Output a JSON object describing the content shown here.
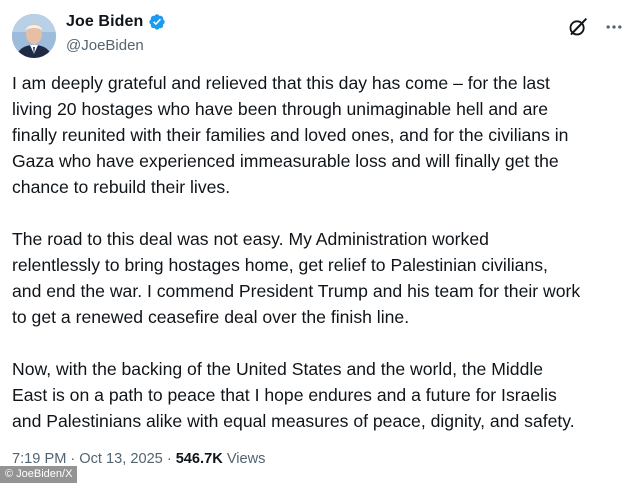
{
  "author": {
    "display_name": "Joe Biden",
    "handle": "@JoeBiden",
    "verified": true
  },
  "icons": {
    "avatar": "profile-photo",
    "verified": "verified-badge-icon",
    "grok": "grok-icon",
    "more": "more-icon"
  },
  "colors": {
    "verified_blue": "#1d9bf0",
    "text_primary": "#0f1419",
    "text_secondary": "#536471"
  },
  "post": {
    "paragraphs": [
      "I am deeply grateful and relieved that this day has come – for the last\nliving 20 hostages who have been through unimaginable hell and are\nfinally reunited with their families and loved ones, and for the civilians in\nGaza who have experienced immeasurable loss and will finally get the\nchance to rebuild their lives.",
      "The road to this deal was not easy. My Administration worked\nrelentlessly to bring hostages home, get relief to Palestinian civilians,\nand end the war. I commend President Trump and his team for their work\nto get a renewed ceasefire deal over the finish line.",
      "Now, with the backing of the United States and the world, the Middle\nEast is on a path to peace that I hope endures and a future for Israelis\nand Palestinians alike with equal measures of peace, dignity, and safety."
    ]
  },
  "meta": {
    "time": "7:19 PM",
    "separator": "·",
    "date": "Oct 13, 2025",
    "views_count": "546.7K",
    "views_label": "Views"
  },
  "credit": "© JoeBiden/X"
}
